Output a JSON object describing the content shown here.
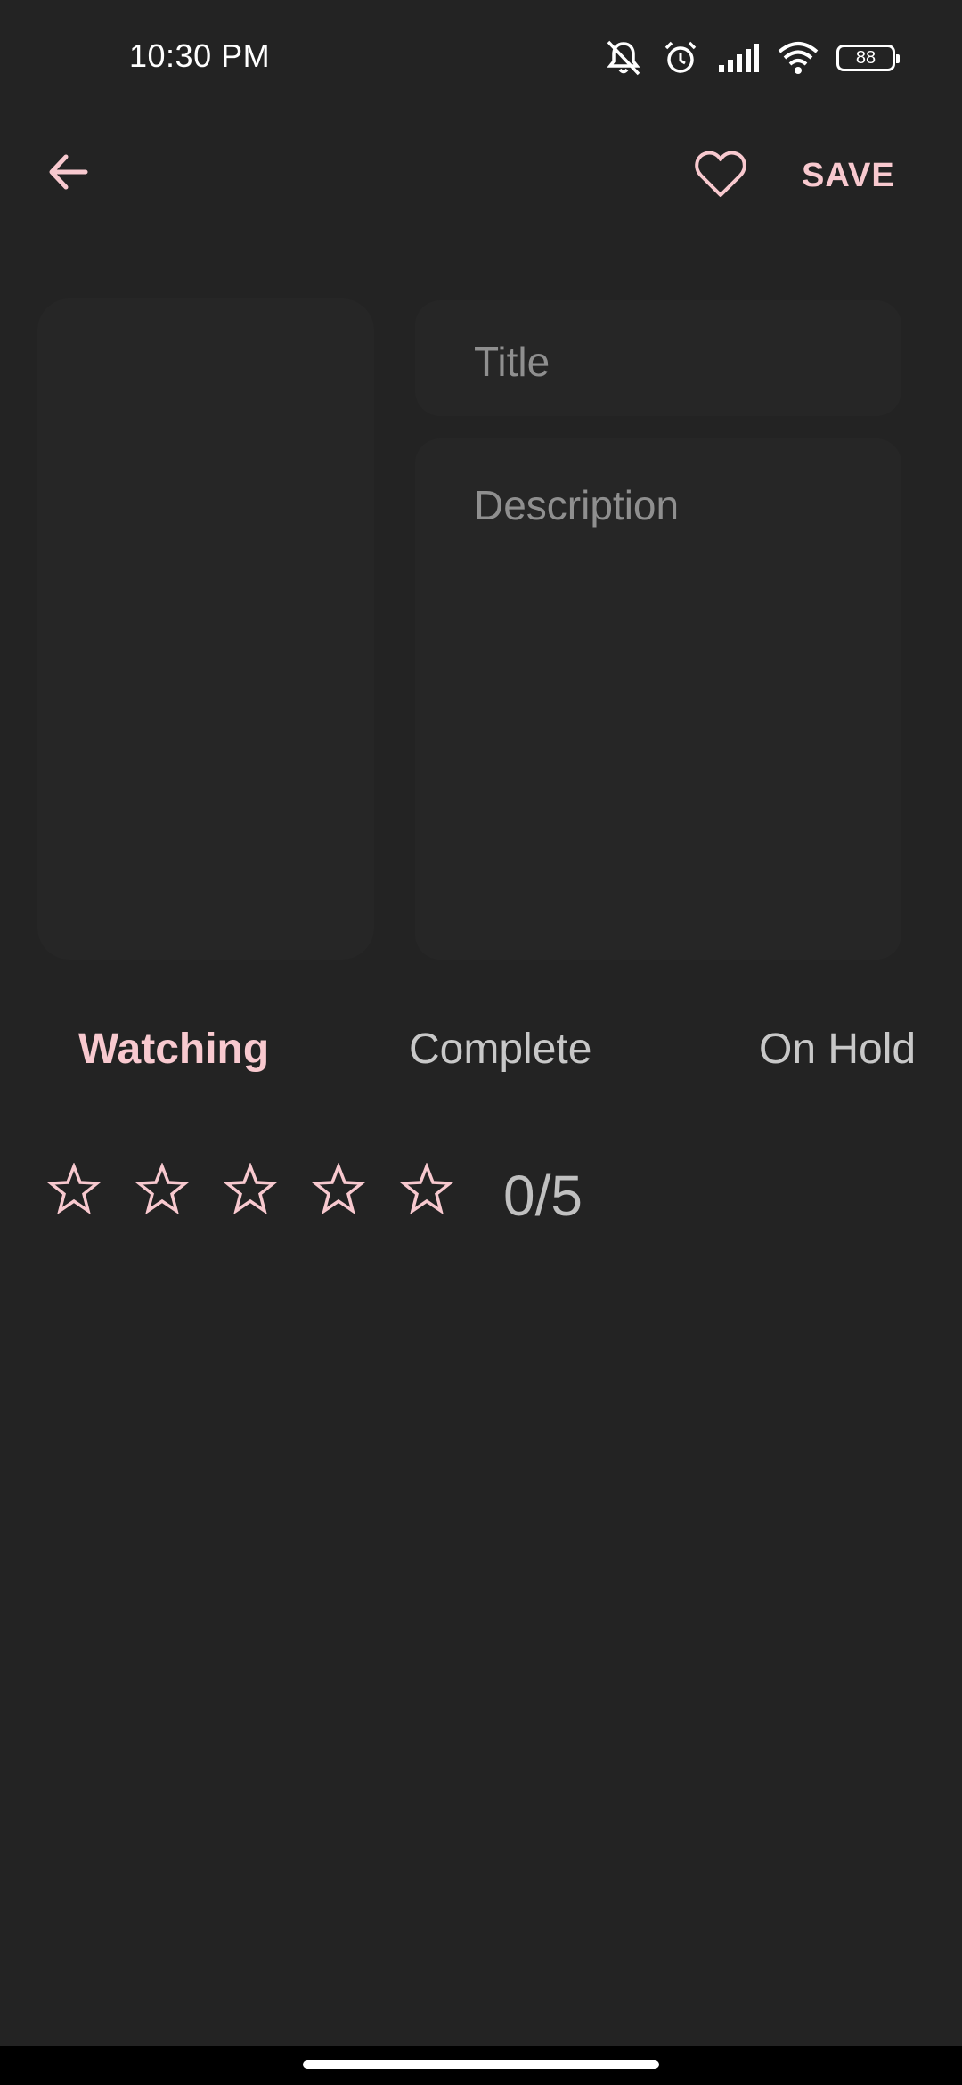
{
  "status_bar": {
    "time": "10:30 PM",
    "battery_level": "88",
    "icons": [
      "mute-icon",
      "alarm-icon",
      "signal-icon",
      "wifi-icon",
      "battery-icon"
    ]
  },
  "app_bar": {
    "back_icon": "arrow-left-icon",
    "favorite_icon": "heart-outline-icon",
    "save_label": "SAVE"
  },
  "form": {
    "title_placeholder": "Title",
    "description_placeholder": "Description"
  },
  "status_tabs": {
    "items": [
      {
        "label": "Watching",
        "active": true
      },
      {
        "label": "Complete",
        "active": false
      },
      {
        "label": "On Hold",
        "active": false
      }
    ]
  },
  "rating": {
    "stars_total": 5,
    "stars_filled": 0,
    "label": "0/5"
  },
  "colors": {
    "background": "#232323",
    "card": "#262626",
    "accent": "#f8c9cf",
    "text_muted": "#8f8f8f"
  }
}
